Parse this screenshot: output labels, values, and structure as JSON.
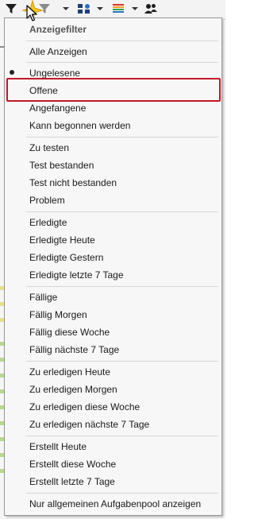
{
  "toolbar": {
    "buttons": [
      {
        "icon": "filter-icon"
      },
      {
        "icon": "filter-grey-icon"
      },
      {
        "icon": "group-icon"
      },
      {
        "icon": "color-bars-icon"
      },
      {
        "icon": "users-icon"
      }
    ]
  },
  "menu": {
    "header": "Anzeigefilter",
    "selected": "Offene",
    "items": [
      {
        "label": "Alle Anzeigen"
      },
      {
        "label": "Ungelesene"
      },
      {
        "label": "Offene"
      },
      {
        "label": "Angefangene"
      },
      {
        "label": "Kann begonnen werden"
      },
      {
        "label": "Zu testen"
      },
      {
        "label": "Test bestanden"
      },
      {
        "label": "Test nicht bestanden"
      },
      {
        "label": "Problem"
      },
      {
        "label": "Erledigte"
      },
      {
        "label": "Erledigte Heute"
      },
      {
        "label": "Erledigte Gestern"
      },
      {
        "label": "Erledigte letzte 7 Tage"
      },
      {
        "label": "Fällige"
      },
      {
        "label": "Fällig Morgen"
      },
      {
        "label": "Fällig diese Woche"
      },
      {
        "label": "Fällig nächste 7 Tage"
      },
      {
        "label": "Zu erledigen Heute"
      },
      {
        "label": "Zu erledigen Morgen"
      },
      {
        "label": "Zu erledigen diese Woche"
      },
      {
        "label": "Zu erledigen nächste 7 Tage"
      },
      {
        "label": "Erstellt Heute"
      },
      {
        "label": "Erstellt diese Woche"
      },
      {
        "label": "Erstellt letzte 7 Tage"
      },
      {
        "label": "Nur allgemeinen Aufgabenpool anzeigen"
      }
    ]
  },
  "colors": {
    "highlight_border": "#c0182a",
    "menu_bg": "#f7f7f7"
  }
}
